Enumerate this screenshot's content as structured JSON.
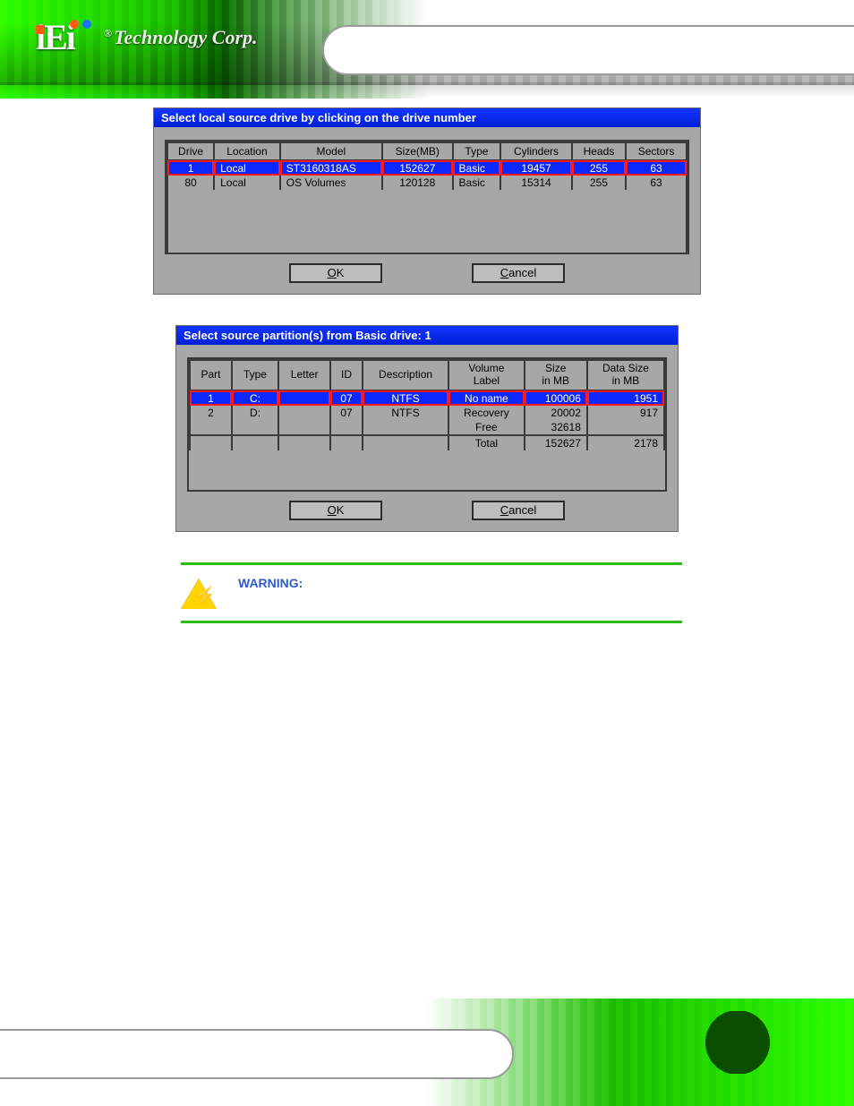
{
  "header": {
    "brand": "iEi",
    "brand_tag": "®Technology Corp.",
    "doc_title": ""
  },
  "footer": {
    "page_number": "",
    "doc_title": ""
  },
  "dialog1": {
    "title": "Select local source drive by clicking on the drive number",
    "columns": [
      "Drive",
      "Location",
      "Model",
      "Size(MB)",
      "Type",
      "Cylinders",
      "Heads",
      "Sectors"
    ],
    "rows": [
      {
        "selected": true,
        "Drive": "1",
        "Location": "Local",
        "Model": "ST3160318AS",
        "SizeMB": "152627",
        "Type": "Basic",
        "Cylinders": "19457",
        "Heads": "255",
        "Sectors": "63"
      },
      {
        "selected": false,
        "Drive": "80",
        "Location": "Local",
        "Model": "OS Volumes",
        "SizeMB": "120128",
        "Type": "Basic",
        "Cylinders": "15314",
        "Heads": "255",
        "Sectors": "63"
      }
    ],
    "ok_label": "OK",
    "cancel_label": "Cancel"
  },
  "caption1": "",
  "step_text_1a": "",
  "step_text_1b": "",
  "dialog2": {
    "title": "Select source partition(s) from Basic drive: 1",
    "columns": [
      "Part",
      "Type",
      "Letter",
      "ID",
      "Description",
      "Volume\nLabel",
      "Size\nin MB",
      "Data Size\nin MB"
    ],
    "rows": [
      {
        "selected": true,
        "Part": "1",
        "Type": "C:",
        "Letter": "",
        "ID": "07",
        "Description": "NTFS",
        "Volume": "No name",
        "Size": "100006",
        "DataSize": "1951"
      },
      {
        "selected": false,
        "Part": "2",
        "Type": "D:",
        "Letter": "",
        "ID": "07",
        "Description": "NTFS",
        "Volume": "Recovery",
        "Size": "20002",
        "DataSize": "917"
      },
      {
        "selected": false,
        "Part": "",
        "Type": "",
        "Letter": "",
        "ID": "",
        "Description": "",
        "Volume": "Free",
        "Size": "32618",
        "DataSize": ""
      }
    ],
    "totals": {
      "label": "Total",
      "size": "152627",
      "data": "2178"
    },
    "ok_label": "OK",
    "cancel_label": "Cancel"
  },
  "caption2": "",
  "step_text_2a": "",
  "step_text_2b": "",
  "warning": {
    "title": "WARNING:",
    "body": ""
  }
}
